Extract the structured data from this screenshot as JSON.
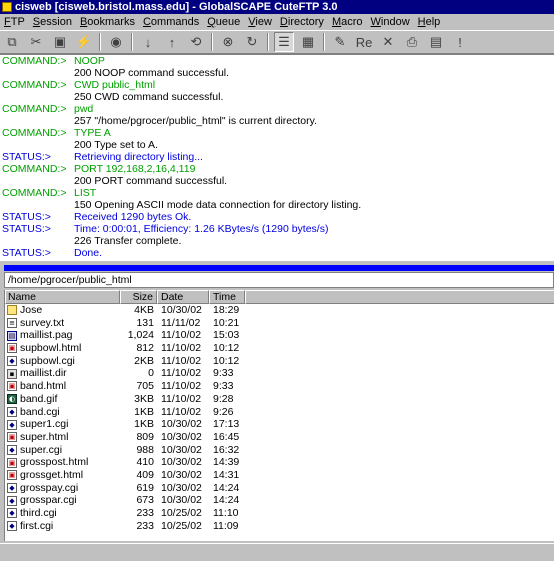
{
  "window": {
    "title": "cisweb [cisweb.bristol.mass.edu] - GlobalSCAPE CuteFTP 3.0"
  },
  "menu": [
    "FTP",
    "Session",
    "Bookmarks",
    "Commands",
    "Queue",
    "View",
    "Directory",
    "Macro",
    "Window",
    "Help"
  ],
  "toolbar": {
    "buttons": [
      {
        "icon": "connect-icon",
        "glyph": "⧉",
        "active": false
      },
      {
        "icon": "disconnect-icon",
        "glyph": "✂",
        "active": false
      },
      {
        "icon": "site-manager-icon",
        "glyph": "▣",
        "active": false
      },
      {
        "icon": "quick-connect-icon",
        "glyph": "⚡",
        "active": false
      },
      {
        "sep": true
      },
      {
        "icon": "refresh-icon",
        "glyph": "◉",
        "active": false
      },
      {
        "sep": true
      },
      {
        "icon": "download-icon",
        "glyph": "↓",
        "active": false
      },
      {
        "icon": "upload-icon",
        "glyph": "↑",
        "active": false
      },
      {
        "icon": "queue-icon",
        "glyph": "⟲",
        "active": false
      },
      {
        "sep": true
      },
      {
        "icon": "stop-icon",
        "glyph": "⊗",
        "active": false
      },
      {
        "icon": "reconnect-icon",
        "glyph": "↻",
        "active": false
      },
      {
        "sep": true
      },
      {
        "icon": "list-view-icon",
        "glyph": "☰",
        "active": true
      },
      {
        "icon": "detail-view-icon",
        "glyph": "▦",
        "active": false
      },
      {
        "sep": true
      },
      {
        "icon": "edit-icon",
        "glyph": "✎",
        "active": false
      },
      {
        "icon": "rename-icon",
        "glyph": "Re",
        "active": false
      },
      {
        "icon": "delete-icon",
        "glyph": "✕",
        "active": false
      },
      {
        "icon": "print-icon",
        "glyph": "⎙",
        "active": false
      },
      {
        "icon": "folder-icon",
        "glyph": "▤",
        "active": false
      },
      {
        "icon": "help-icon",
        "glyph": "!",
        "active": false
      }
    ]
  },
  "log": [
    {
      "prefix": "COMMAND:>",
      "text": "NOOP",
      "kind": "cmd"
    },
    {
      "prefix": "",
      "text": "200 NOOP command successful.",
      "kind": "resp"
    },
    {
      "prefix": "COMMAND:>",
      "text": "CWD public_html",
      "kind": "cmd"
    },
    {
      "prefix": "",
      "text": "250 CWD command successful.",
      "kind": "resp"
    },
    {
      "prefix": "COMMAND:>",
      "text": "pwd",
      "kind": "cmd"
    },
    {
      "prefix": "",
      "text": "257 \"/home/pgrocer/public_html\" is current directory.",
      "kind": "resp"
    },
    {
      "prefix": "COMMAND:>",
      "text": "TYPE A",
      "kind": "cmd"
    },
    {
      "prefix": "",
      "text": "200 Type set to A.",
      "kind": "resp"
    },
    {
      "prefix": "STATUS:>",
      "text": "Retrieving directory listing...",
      "kind": "status"
    },
    {
      "prefix": "COMMAND:>",
      "text": "PORT 192,168,2,16,4,119",
      "kind": "cmd"
    },
    {
      "prefix": "",
      "text": "200 PORT command successful.",
      "kind": "resp"
    },
    {
      "prefix": "COMMAND:>",
      "text": "LIST",
      "kind": "cmd"
    },
    {
      "prefix": "",
      "text": "150 Opening ASCII mode data connection for directory listing.",
      "kind": "resp"
    },
    {
      "prefix": "STATUS:>",
      "text": "Received 1290 bytes Ok.",
      "kind": "status"
    },
    {
      "prefix": "STATUS:>",
      "text": "Time: 0:00:01, Efficiency: 1.26 KBytes/s (1290 bytes/s)",
      "kind": "status"
    },
    {
      "prefix": "",
      "text": "226 Transfer complete.",
      "kind": "resp"
    },
    {
      "prefix": "STATUS:>",
      "text": "Done.",
      "kind": "status"
    }
  ],
  "path": "/home/pgrocer/public_html",
  "columns": {
    "name": "Name",
    "size": "Size",
    "date": "Date",
    "time": "Time"
  },
  "files": [
    {
      "name": "Jose",
      "size": "4KB",
      "date": "10/30/02",
      "time": "18:29",
      "icon": "folder"
    },
    {
      "name": "survey.txt",
      "size": "131",
      "date": "11/11/02",
      "time": "10:21",
      "icon": "txt"
    },
    {
      "name": "maillist.pag",
      "size": "1,024",
      "date": "11/10/02",
      "time": "15:03",
      "icon": "app"
    },
    {
      "name": "supbowl.html",
      "size": "812",
      "date": "11/10/02",
      "time": "10:12",
      "icon": "html"
    },
    {
      "name": "supbowl.cgi",
      "size": "2KB",
      "date": "11/10/02",
      "time": "10:12",
      "icon": "cgi"
    },
    {
      "name": "maillist.dir",
      "size": "0",
      "date": "11/10/02",
      "time": "9:33",
      "icon": "dir"
    },
    {
      "name": "band.html",
      "size": "705",
      "date": "11/10/02",
      "time": "9:33",
      "icon": "html"
    },
    {
      "name": "band.gif",
      "size": "3KB",
      "date": "11/10/02",
      "time": "9:28",
      "icon": "gif"
    },
    {
      "name": "band.cgi",
      "size": "1KB",
      "date": "11/10/02",
      "time": "9:26",
      "icon": "cgi"
    },
    {
      "name": "super1.cgi",
      "size": "1KB",
      "date": "10/30/02",
      "time": "17:13",
      "icon": "cgi"
    },
    {
      "name": "super.html",
      "size": "809",
      "date": "10/30/02",
      "time": "16:45",
      "icon": "html"
    },
    {
      "name": "super.cgi",
      "size": "988",
      "date": "10/30/02",
      "time": "16:32",
      "icon": "cgi"
    },
    {
      "name": "grosspost.html",
      "size": "410",
      "date": "10/30/02",
      "time": "14:39",
      "icon": "html"
    },
    {
      "name": "grossget.html",
      "size": "409",
      "date": "10/30/02",
      "time": "14:31",
      "icon": "html"
    },
    {
      "name": "grosspay.cgi",
      "size": "619",
      "date": "10/30/02",
      "time": "14:24",
      "icon": "cgi"
    },
    {
      "name": "grosspar.cgi",
      "size": "673",
      "date": "10/30/02",
      "time": "14:24",
      "icon": "cgi"
    },
    {
      "name": "third.cgi",
      "size": "233",
      "date": "10/25/02",
      "time": "11:10",
      "icon": "cgi"
    },
    {
      "name": "first.cgi",
      "size": "233",
      "date": "10/25/02",
      "time": "11:09",
      "icon": "cgi"
    }
  ]
}
